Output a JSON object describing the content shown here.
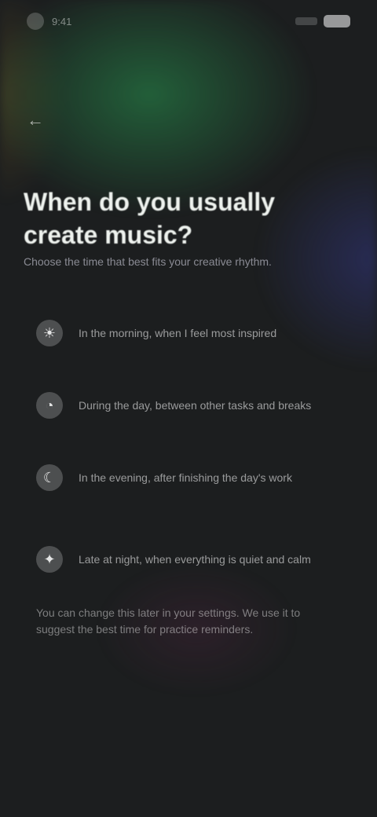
{
  "status": {
    "time": "9:41",
    "battery_icon": "battery-icon",
    "signal_icon": "signal-icon"
  },
  "nav": {
    "back_icon": "arrow-left-icon",
    "back_glyph": "←"
  },
  "header": {
    "title": "When do you usually create music?",
    "subtitle": "Choose the time that best fits your creative rhythm."
  },
  "options": [
    {
      "icon": "sun-icon",
      "glyph": "☀",
      "label": "In the morning, when I feel most inspired"
    },
    {
      "icon": "clock-icon",
      "glyph": "◔",
      "label": "During the day, between other tasks and breaks"
    },
    {
      "icon": "moon-icon",
      "glyph": "☾",
      "label": "In the evening, after finishing the day's work"
    },
    {
      "icon": "star-icon",
      "glyph": "✦",
      "label": "Late at night, when everything is quiet and calm"
    }
  ],
  "footer": {
    "note": "You can change this later in your settings. We use it to suggest the best time for practice reminders."
  }
}
